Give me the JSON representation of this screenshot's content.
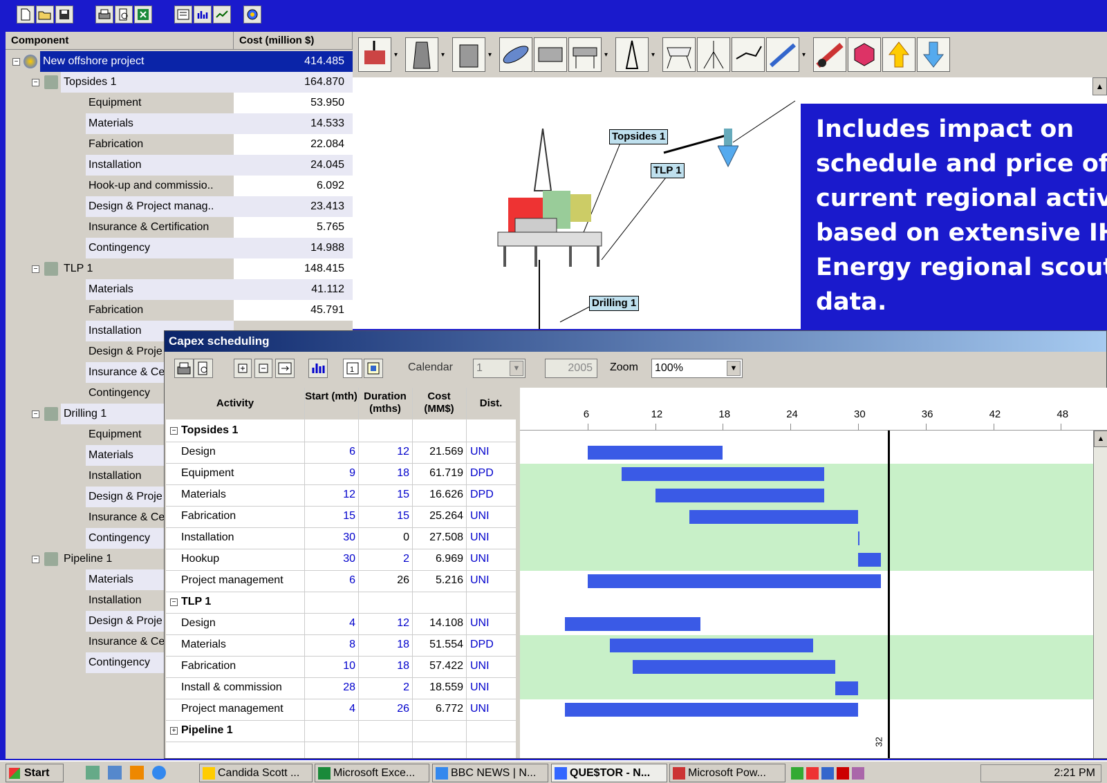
{
  "colors": {
    "accent": "#1a1acc",
    "selection": "#0a24a8",
    "bar": "#3a5ae6",
    "band": "#c8f0c8"
  },
  "tree": {
    "header_component": "Component",
    "header_cost": "Cost (million $)",
    "rows": [
      {
        "name": "New offshore project",
        "cost": "414.485",
        "icon": "globe-icon"
      },
      {
        "name": "Topsides 1",
        "cost": "164.870",
        "icon": "platform-icon"
      },
      {
        "name": "Equipment",
        "cost": "53.950"
      },
      {
        "name": "Materials",
        "cost": "14.533"
      },
      {
        "name": "Fabrication",
        "cost": "22.084"
      },
      {
        "name": "Installation",
        "cost": "24.045"
      },
      {
        "name": "Hook-up and commissio..",
        "cost": "6.092"
      },
      {
        "name": "Design & Project manag..",
        "cost": "23.413"
      },
      {
        "name": "Insurance & Certification",
        "cost": "5.765"
      },
      {
        "name": "Contingency",
        "cost": "14.988"
      },
      {
        "name": "TLP 1",
        "cost": "148.415",
        "icon": "tlp-icon"
      },
      {
        "name": "Materials",
        "cost": "41.112"
      },
      {
        "name": "Fabrication",
        "cost": "45.791"
      },
      {
        "name": "Installation",
        "cost": ""
      },
      {
        "name": "Design & Proje",
        "cost": ""
      },
      {
        "name": "Insurance & Ce",
        "cost": ""
      },
      {
        "name": "Contingency",
        "cost": ""
      },
      {
        "name": "Drilling 1",
        "cost": "",
        "icon": "drilling-icon"
      },
      {
        "name": "Equipment",
        "cost": ""
      },
      {
        "name": "Materials",
        "cost": ""
      },
      {
        "name": "Installation",
        "cost": ""
      },
      {
        "name": "Design & Proje",
        "cost": ""
      },
      {
        "name": "Insurance & Ce",
        "cost": ""
      },
      {
        "name": "Contingency",
        "cost": ""
      },
      {
        "name": "Pipeline 1",
        "cost": "",
        "icon": "pipeline-icon"
      },
      {
        "name": "Materials",
        "cost": ""
      },
      {
        "name": "Installation",
        "cost": ""
      },
      {
        "name": "Design & Proje",
        "cost": ""
      },
      {
        "name": "Insurance & Ce",
        "cost": ""
      },
      {
        "name": "Contingency",
        "cost": ""
      }
    ]
  },
  "labels": {
    "topsides": "Topsides 1",
    "tlp": "TLP 1",
    "drilling": "Drilling 1"
  },
  "overlay": {
    "lines": [
      "Includes impact on",
      "schedule and price of",
      "current regional activity",
      "based on extensive IHS",
      "Energy regional scout",
      "data."
    ]
  },
  "capex": {
    "title": "Capex scheduling",
    "calendar_label": "Calendar",
    "calendar_value": "1",
    "year": "2005",
    "zoom_label": "Zoom",
    "zoom_value": "100%",
    "headers": {
      "activity": "Activity",
      "start": "Start (mth)",
      "duration": "Duration (mths)",
      "cost": "Cost (MM$)",
      "dist": "Dist."
    },
    "ticks": [
      "6",
      "12",
      "18",
      "24",
      "30",
      "36",
      "42",
      "48"
    ],
    "marker_label": "32",
    "groups": [
      {
        "name": "Topsides 1",
        "expanded": true,
        "rows": [
          {
            "activity": "Design",
            "start": 6,
            "duration": 12,
            "cost": "21.569",
            "dist": "UNI"
          },
          {
            "activity": "Equipment",
            "start": 9,
            "duration": 18,
            "cost": "61.719",
            "dist": "DPD"
          },
          {
            "activity": "Materials",
            "start": 12,
            "duration": 15,
            "cost": "16.626",
            "dist": "DPD"
          },
          {
            "activity": "Fabrication",
            "start": 15,
            "duration": 15,
            "cost": "25.264",
            "dist": "UNI"
          },
          {
            "activity": "Installation",
            "start": 30,
            "duration": 0,
            "cost": "27.508",
            "dist": "UNI"
          },
          {
            "activity": "Hookup",
            "start": 30,
            "duration": 2,
            "cost": "6.969",
            "dist": "UNI"
          },
          {
            "activity": "Project management",
            "start": 6,
            "duration": 26,
            "cost": "5.216",
            "dist": "UNI"
          }
        ]
      },
      {
        "name": "TLP 1",
        "expanded": true,
        "rows": [
          {
            "activity": "Design",
            "start": 4,
            "duration": 12,
            "cost": "14.108",
            "dist": "UNI"
          },
          {
            "activity": "Materials",
            "start": 8,
            "duration": 18,
            "cost": "51.554",
            "dist": "DPD"
          },
          {
            "activity": "Fabrication",
            "start": 10,
            "duration": 18,
            "cost": "57.422",
            "dist": "UNI"
          },
          {
            "activity": "Install & commission",
            "start": 28,
            "duration": 2,
            "cost": "18.559",
            "dist": "UNI"
          },
          {
            "activity": "Project management",
            "start": 4,
            "duration": 26,
            "cost": "6.772",
            "dist": "UNI"
          }
        ]
      },
      {
        "name": "Pipeline 1",
        "expanded": false,
        "rows": []
      }
    ]
  },
  "taskbar": {
    "start": "Start",
    "tasks": [
      "Candida Scott ...",
      "Microsoft Exce...",
      "BBC NEWS | N...",
      "QUE$TOR - N...",
      "Microsoft Pow..."
    ],
    "clock": "2:21 PM"
  }
}
